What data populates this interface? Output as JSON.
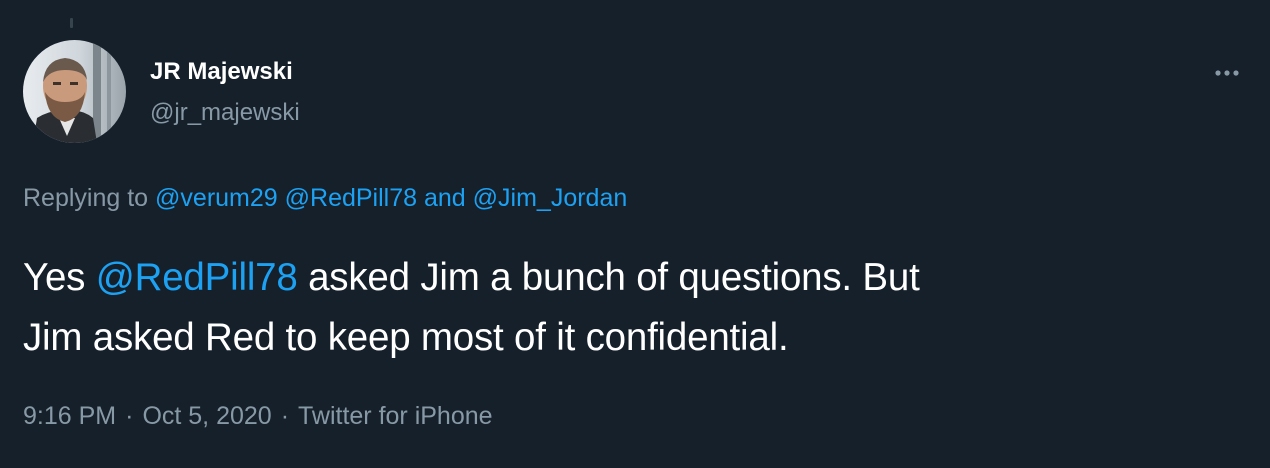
{
  "author": {
    "name": "JR Majewski",
    "handle": "@jr_majewski"
  },
  "reply": {
    "prefix": "Replying to",
    "mentions": [
      "@verum29",
      "@RedPill78"
    ],
    "conjunction": "and",
    "last_mention": "@Jim_Jordan"
  },
  "tweet": {
    "line1_start": "Yes",
    "mention": "@RedPill78",
    "line1_end": "asked Jim a bunch of questions. But",
    "line2": "Jim asked Red to keep most of it confidential."
  },
  "meta": {
    "time": "9:16 PM",
    "separator": "·",
    "date": "Oct 5, 2020",
    "client": "Twitter for iPhone"
  },
  "icons": {
    "more": "more-horizontal-icon"
  },
  "colors": {
    "background": "#15202b",
    "primary_text": "#ffffff",
    "secondary_text": "#8899a6",
    "link": "#1da1f2"
  }
}
